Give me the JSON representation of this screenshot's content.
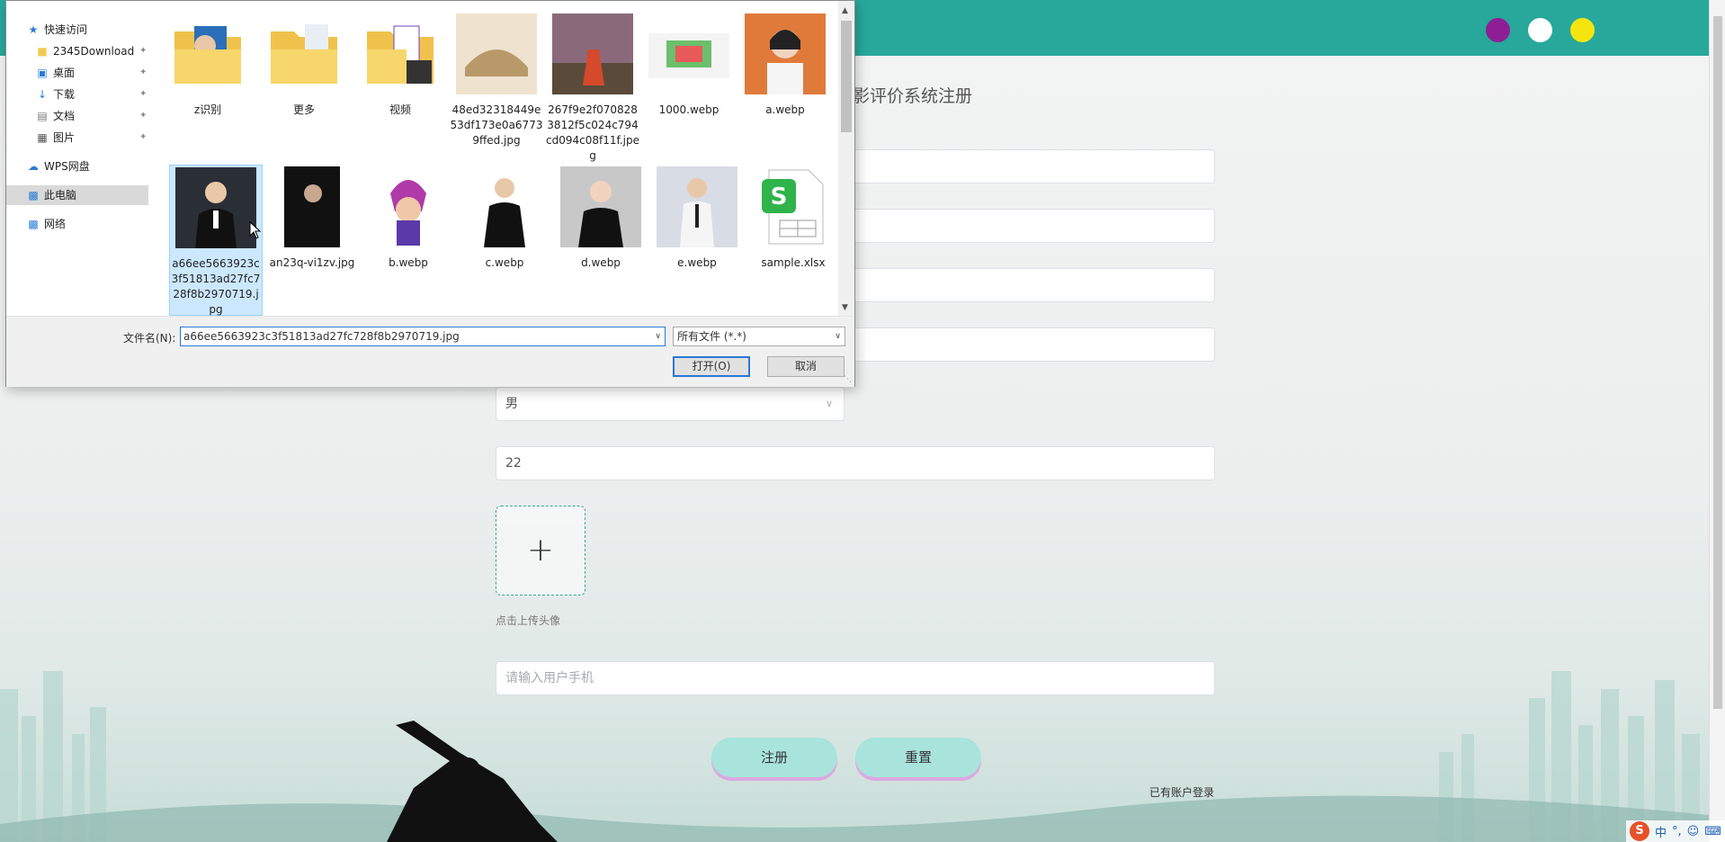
{
  "page": {
    "title_fragment": "影评价系统注册",
    "fields": [
      {
        "value": "",
        "placeholder": ""
      },
      {
        "value": "",
        "placeholder": ""
      },
      {
        "value": "",
        "placeholder": ""
      },
      {
        "value": "",
        "placeholder": ""
      }
    ],
    "gender_value": "男",
    "age_value": "22",
    "upload_tip": "点击上传头像",
    "phone_placeholder": "请输入用户手机",
    "register_label": "注册",
    "reset_label": "重置",
    "login_link": "已有账户登录",
    "dots": [
      "#8e1e94",
      "#ffffff",
      "#f5e50f"
    ],
    "accent": "#27a89b"
  },
  "tray": {
    "ime": "中",
    "punct": "°,"
  },
  "dialog": {
    "nav": [
      {
        "label": "快速访问",
        "icon": "star-icon"
      },
      {
        "label": "2345Download",
        "icon": "folder-icon",
        "pinned": true
      },
      {
        "label": "桌面",
        "icon": "desktop-icon",
        "pinned": true
      },
      {
        "label": "下载",
        "icon": "download-icon",
        "pinned": true
      },
      {
        "label": "文档",
        "icon": "document-icon",
        "pinned": true
      },
      {
        "label": "图片",
        "icon": "picture-icon",
        "pinned": true
      },
      {
        "label": "WPS网盘",
        "icon": "cloud-icon"
      },
      {
        "label": "此电脑",
        "icon": "computer-icon",
        "selected": true
      },
      {
        "label": "网络",
        "icon": "network-icon"
      }
    ],
    "files": [
      {
        "name": "z识别",
        "kind": "folder"
      },
      {
        "name": "更多",
        "kind": "folder"
      },
      {
        "name": "视频",
        "kind": "folder"
      },
      {
        "name": "48ed32318449e53df173e0a67739ffed.jpg",
        "kind": "image"
      },
      {
        "name": "267f9e2f0708283812f5c024c794cd094c08f11f.jpeg",
        "kind": "image"
      },
      {
        "name": "1000.webp",
        "kind": "image"
      },
      {
        "name": "a.webp",
        "kind": "image"
      },
      {
        "name": "a66ee5663923c3f51813ad27fc728f8b2970719.jpg",
        "kind": "image",
        "selected": true
      },
      {
        "name": "an23q-vi1zv.jpg",
        "kind": "image"
      },
      {
        "name": "b.webp",
        "kind": "image"
      },
      {
        "name": "c.webp",
        "kind": "image"
      },
      {
        "name": "d.webp",
        "kind": "image"
      },
      {
        "name": "e.webp",
        "kind": "image"
      },
      {
        "name": "sample.xlsx",
        "kind": "spreadsheet"
      }
    ],
    "filename_label": "文件名(N):",
    "filename_value": "a66ee5663923c3f51813ad27fc728f8b2970719.jpg",
    "filetype_value": "所有文件 (*.*)",
    "open_label": "打开(O)",
    "cancel_label": "取消"
  }
}
